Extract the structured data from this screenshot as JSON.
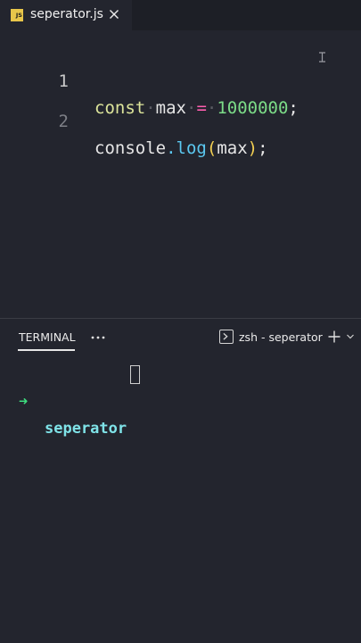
{
  "tab": {
    "title": "seperator.js",
    "badge": "JS"
  },
  "editor": {
    "lines": [
      {
        "number": "1",
        "tokens": [
          "const",
          "max",
          "=",
          "1000000",
          ";"
        ]
      },
      {
        "number": "2",
        "tokens": [
          "console",
          ".",
          "log",
          "(",
          "max",
          ")",
          ";"
        ]
      }
    ],
    "whitespace_marker": "·"
  },
  "terminal": {
    "tab_label": "TERMINAL",
    "shell_name": "zsh - seperator",
    "prompt_arrow": "➜",
    "cwd": "seperator"
  },
  "colors": {
    "background": "#23252e",
    "keyword": "#dde59b",
    "operator": "#ff5fb0",
    "number": "#7cdc88",
    "function": "#5bc8f0",
    "paren": "#f2cf52",
    "prompt_arrow": "#3ddc7e",
    "cwd": "#7fe3e8"
  },
  "icons": [
    "js-file-icon",
    "close-icon",
    "text-cursor-icon",
    "more-icon",
    "terminal-icon",
    "plus-icon",
    "chevron-down-icon"
  ]
}
